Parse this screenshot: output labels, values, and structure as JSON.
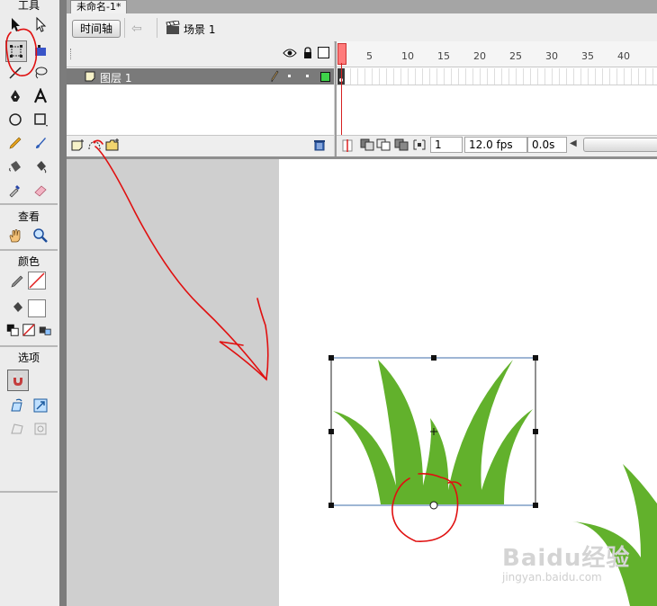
{
  "document": {
    "tab_title": "未命名-1*"
  },
  "editbar": {
    "timeline_button": "时间轴",
    "scene_label": "场景 1"
  },
  "tools": {
    "title": "工具",
    "view_title": "查看",
    "color_title": "颜色",
    "options_title": "选项"
  },
  "layers": {
    "items": [
      {
        "name": "图层 1"
      }
    ]
  },
  "timeline": {
    "ruler": [
      "1",
      "5",
      "10",
      "15",
      "20",
      "25",
      "30",
      "35",
      "40"
    ],
    "current_frame": "1",
    "frame_rate": "12.0 fps",
    "elapsed_time": "0.0s"
  },
  "watermark": {
    "main": "Baidu经验",
    "sub": "jingyan.baidu.com"
  },
  "colors": {
    "grass": "#62b12c",
    "annotation": "#e01010",
    "layer_selected": "#7a7a7a",
    "outline_color_square": "#3ed34a"
  }
}
